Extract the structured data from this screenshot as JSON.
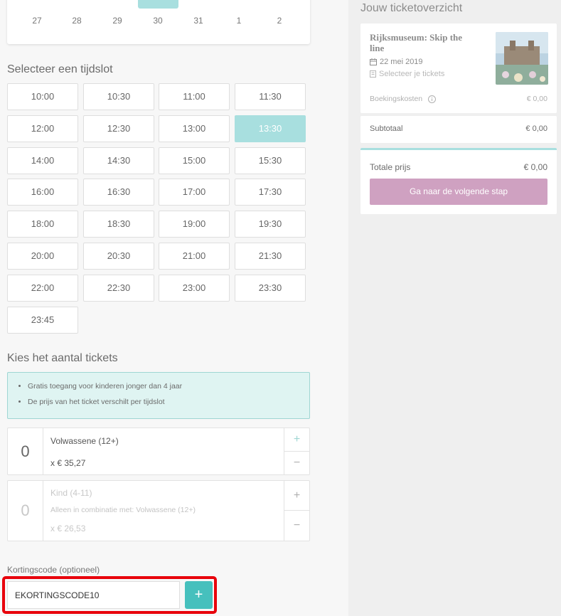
{
  "calendar": {
    "days": [
      "27",
      "28",
      "29",
      "30",
      "31",
      "1",
      "2"
    ],
    "selected_day": "30"
  },
  "timeslots": {
    "title": "Selecteer een tijdslot",
    "selected": "13:30",
    "slots": [
      "10:00",
      "10:30",
      "11:00",
      "11:30",
      "12:00",
      "12:30",
      "13:00",
      "13:30",
      "14:00",
      "14:30",
      "15:00",
      "15:30",
      "16:00",
      "16:30",
      "17:00",
      "17:30",
      "18:00",
      "18:30",
      "19:00",
      "19:30",
      "20:00",
      "20:30",
      "21:00",
      "21:30",
      "22:00",
      "22:30",
      "23:00",
      "23:30",
      "23:45"
    ]
  },
  "tickets": {
    "title": "Kies het aantal tickets",
    "info": [
      "Gratis toegang voor kinderen jonger dan 4 jaar",
      "De prijs van het ticket verschilt per tijdslot"
    ],
    "adult": {
      "count": "0",
      "name": "Volwassene (12+)",
      "price": "x € 35,27"
    },
    "child": {
      "count": "0",
      "name": "Kind (4-11)",
      "note": "Alleen in combinatie met: Volwassene (12+)",
      "price": "x € 26,53"
    }
  },
  "discount": {
    "label": "Kortingscode (optioneel)",
    "value": "EKORTINGSCODE10"
  },
  "summary": {
    "title": "Jouw ticketoverzicht",
    "item_title": "Rijksmuseum: Skip the line",
    "date": "22 mei 2019",
    "select_text": "Selecteer je tickets",
    "fee_label": "Boekingskosten",
    "fee_value": "€ 0,00",
    "subtotal_label": "Subtotaal",
    "subtotal_value": "€ 0,00",
    "total_label": "Totale prijs",
    "total_value": "€ 0,00",
    "next_button": "Ga naar de volgende stap"
  },
  "colors": {
    "accent": "#46c0bd",
    "selected_slot": "#a8dfdf",
    "next_button": "#cfa1c1",
    "highlight_border": "#e8000b"
  }
}
